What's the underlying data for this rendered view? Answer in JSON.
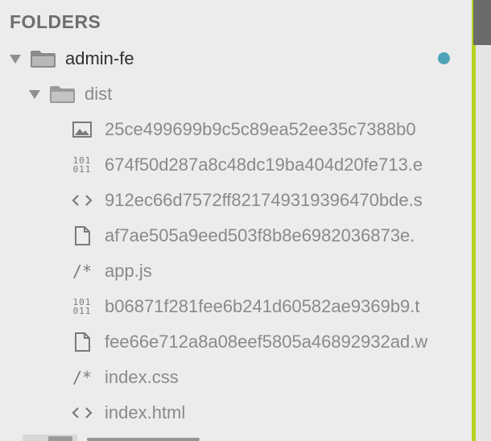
{
  "sidebar": {
    "title": "FOLDERS",
    "root_folder": {
      "name": "admin-fe",
      "expanded": true,
      "modified_indicator_color": "#4fa3b8"
    },
    "sub_folder": {
      "name": "dist",
      "expanded": true
    },
    "files": [
      {
        "name": "25ce499699b9c5c89ea52ee35c7388b0",
        "icon": "image-icon"
      },
      {
        "name": "674f50d287a8c48dc19ba404d20fe713.e",
        "icon": "binary-icon"
      },
      {
        "name": "912ec66d7572ff821749319396470bde.s",
        "icon": "code-icon"
      },
      {
        "name": "af7ae505a9eed503f8b8e6982036873e.",
        "icon": "file-icon"
      },
      {
        "name": "app.js",
        "icon": "comment-icon"
      },
      {
        "name": "b06871f281fee6b241d60582ae9369b9.t",
        "icon": "binary-icon"
      },
      {
        "name": "fee66e712a8a08eef5805a46892932ad.w",
        "icon": "file-icon"
      },
      {
        "name": "index.css",
        "icon": "comment-icon"
      },
      {
        "name": "index.html",
        "icon": "code-icon"
      }
    ]
  },
  "colors": {
    "background": "#ececec",
    "accent_bar": "#b9d21f",
    "scroll_thumb": "#6a6a6a"
  }
}
